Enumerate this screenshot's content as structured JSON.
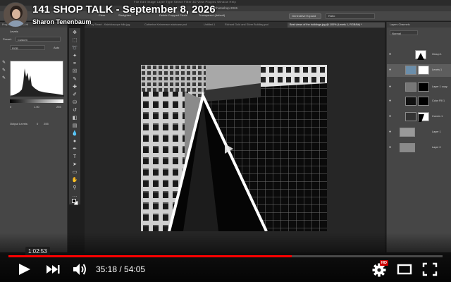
{
  "video": {
    "title": "141 SHOP TALK - September 8, 2026",
    "channel": "Sharon Tenenbaum",
    "current_time": "35:18",
    "duration": "54:05",
    "time_display": "35:18 / 54:05",
    "hover_tooltip": "1:02:53",
    "progress_fraction": 0.6527,
    "hover_fraction": 0.245,
    "hd_badge": "HD",
    "accent": "#ff0000"
  },
  "photoshop": {
    "app_title": "Adobe Photoshop 2026",
    "options_bar": {
      "clear_label": "Clear",
      "straighten_label": "Straighten",
      "delete_cropped_label": "Delete Cropped Pixels",
      "fill_label": "Transparent (default)",
      "generative_expand_label": "Generative Expand",
      "ratio_label": "Ratio"
    },
    "tabs": [
      "Lenny Smart - Kaleidoscope hills.jpg",
      "Catherine Keinemann staircase.psd",
      "Untitled-1",
      "Richard Gold and Silver Building.psd",
      "Best views of the buildings.jpg @ 100% (Levels 1, RGB/8#) *"
    ],
    "properties_panel": {
      "tabs": "Properties   Pa   Ad   Li   Hi",
      "panel_name": "Levels",
      "preset_label": "Preset:",
      "preset_value": "Custom",
      "channel_value": "RGB",
      "auto_label": "Auto",
      "input_values": [
        "0",
        "1.00",
        "255"
      ],
      "output_label": "Output Levels:",
      "output_values": [
        "0",
        "255"
      ]
    },
    "layers_panel": {
      "tabs": "Layers   Channels",
      "blend_mode": "Normal",
      "layers": [
        {
          "name": "Group 1"
        },
        {
          "name": "Levels 1"
        },
        {
          "name": "Layer 1 copy"
        },
        {
          "name": "Color Fill 1"
        },
        {
          "name": "Curves 1"
        },
        {
          "name": "Layer 1"
        },
        {
          "name": "Layer 0"
        }
      ]
    }
  },
  "icons": [
    "play-icon",
    "next-icon",
    "volume-icon",
    "settings-icon",
    "theater-icon",
    "fullscreen-icon"
  ]
}
